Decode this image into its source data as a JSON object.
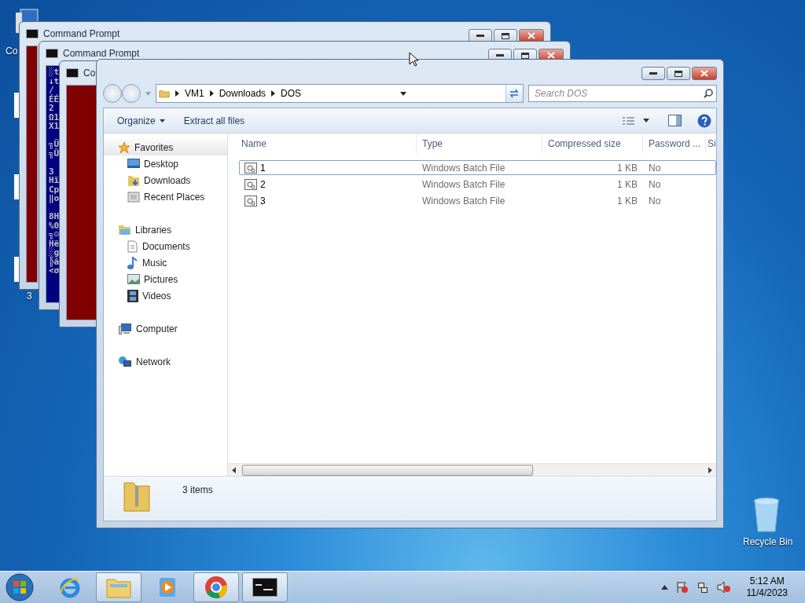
{
  "desktop": {
    "icons": [
      {
        "label": "Co",
        "kind": "computer"
      },
      {
        "label": "3",
        "kind": "file"
      }
    ],
    "recycle_bin": {
      "label": "Recycle Bin"
    }
  },
  "console_windows": [
    {
      "title": "Command Prompt",
      "color": "#800000",
      "controls": true
    },
    {
      "title": "Command Prompt",
      "color": "#000080",
      "controls": true,
      "blocks": [
        [
          "░t",
          "↓t",
          "/",
          "ÉÉ",
          "2",
          "Ω1",
          "X1"
        ],
        [
          "╗Ü",
          "╗Ü"
        ],
        [
          "3",
          "Hï",
          "Cp",
          "‖o"
        ],
        [
          "8H",
          "%0",
          "╗☺",
          "Hë",
          "░g",
          "╠â",
          "<σ"
        ]
      ]
    },
    {
      "title": "Co",
      "color": "#800000",
      "controls": false
    }
  ],
  "explorer": {
    "breadcrumbs": [
      "VM1",
      "Downloads",
      "DOS"
    ],
    "search": {
      "placeholder": "Search DOS"
    },
    "commands": [
      {
        "label": "Organize",
        "menu": true
      },
      {
        "label": "Extract all files",
        "menu": false
      }
    ],
    "nav": [
      {
        "label": "Favorites",
        "kind": "star",
        "hover": true,
        "children": [
          {
            "label": "Desktop",
            "kind": "desktop"
          },
          {
            "label": "Downloads",
            "kind": "downloads"
          },
          {
            "label": "Recent Places",
            "kind": "recent"
          }
        ]
      },
      {
        "label": "Libraries",
        "kind": "library",
        "hover": false,
        "children": [
          {
            "label": "Documents",
            "kind": "document"
          },
          {
            "label": "Music",
            "kind": "music"
          },
          {
            "label": "Pictures",
            "kind": "pictures"
          },
          {
            "label": "Videos",
            "kind": "videos"
          }
        ]
      },
      {
        "label": "Computer",
        "kind": "computer",
        "hover": false
      },
      {
        "label": "Network",
        "kind": "network",
        "hover": false
      }
    ],
    "columns": [
      "Name",
      "Type",
      "Compressed size",
      "Password ...",
      "Si"
    ],
    "rows": [
      {
        "name": "1",
        "type": "Windows Batch File",
        "size": "1 KB",
        "password": "No",
        "selected": true
      },
      {
        "name": "2",
        "type": "Windows Batch File",
        "size": "1 KB",
        "password": "No",
        "selected": false
      },
      {
        "name": "3",
        "type": "Windows Batch File",
        "size": "1 KB",
        "password": "No",
        "selected": false
      }
    ],
    "status": "3 items"
  },
  "taskbar": {
    "apps": [
      {
        "kind": "ie",
        "open": false
      },
      {
        "kind": "explorer",
        "open": true
      },
      {
        "kind": "media",
        "open": false
      },
      {
        "kind": "chrome",
        "open": true
      },
      {
        "kind": "cmd",
        "open": true
      }
    ],
    "time": "5:12 AM",
    "date": "11/4/2023"
  }
}
